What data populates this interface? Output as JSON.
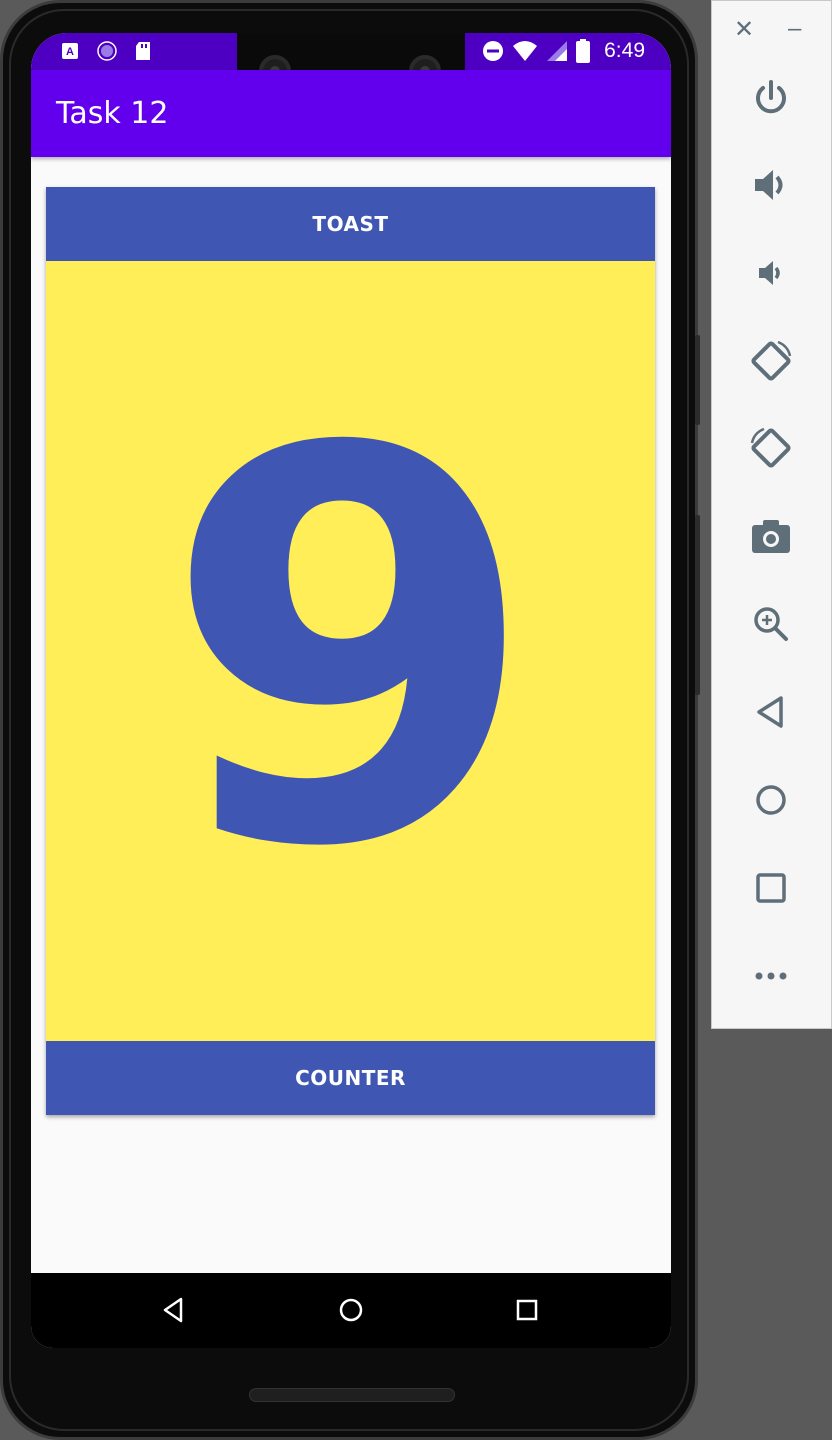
{
  "app": {
    "title": "Task 12",
    "toast_label": "TOAST",
    "counter_label": "COUNTER",
    "count": "9"
  },
  "statusbar": {
    "time": "6:49",
    "left_icons": [
      "a-icon",
      "pinwheel-icon",
      "sd-card-icon"
    ],
    "right_icons": [
      "do-not-disturb-icon",
      "wifi-icon",
      "signal-icon",
      "battery-icon"
    ]
  },
  "navbar": [
    "back-icon",
    "home-icon",
    "recents-icon"
  ],
  "emulator_controls": {
    "window": {
      "close": "✕",
      "minimize": "–"
    },
    "tools": [
      "power-icon",
      "volume-up-icon",
      "volume-down-icon",
      "rotate-left-icon",
      "rotate-right-icon",
      "camera-icon",
      "zoom-icon",
      "back-icon",
      "home-icon",
      "overview-icon",
      "more-icon"
    ]
  },
  "colors": {
    "appbar": "#6200ee",
    "statusbar": "#4d00c2",
    "button": "#3f57b3",
    "count_bg": "#ffee58",
    "count_text": "#3f57b3"
  }
}
